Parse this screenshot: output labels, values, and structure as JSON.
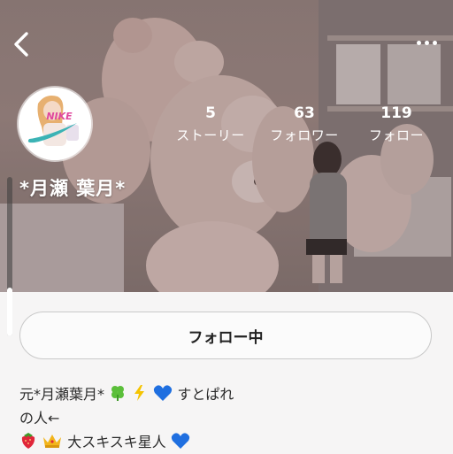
{
  "profile": {
    "display_name": "*月瀬 葉月*",
    "stats": [
      {
        "value": "5",
        "label": "ストーリー"
      },
      {
        "value": "63",
        "label": "フォロワー"
      },
      {
        "value": "119",
        "label": "フォロー"
      }
    ]
  },
  "actions": {
    "follow_label": "フォロー中"
  },
  "bio": {
    "line1_a": "元*月瀬葉月*",
    "line1_b": "すとぱれ",
    "line2": "の人←",
    "line3": "大スキスキ星人"
  },
  "avatar_logo_text": "NIKE",
  "icons": {
    "back": "chevron-left-icon",
    "more": "more-dots-icon"
  },
  "colors": {
    "heart_blue": "#1f6fe0",
    "clover_green": "#5bbf3a",
    "bolt_yellow": "#f5c400",
    "nike_teal": "#3bb3b5"
  }
}
